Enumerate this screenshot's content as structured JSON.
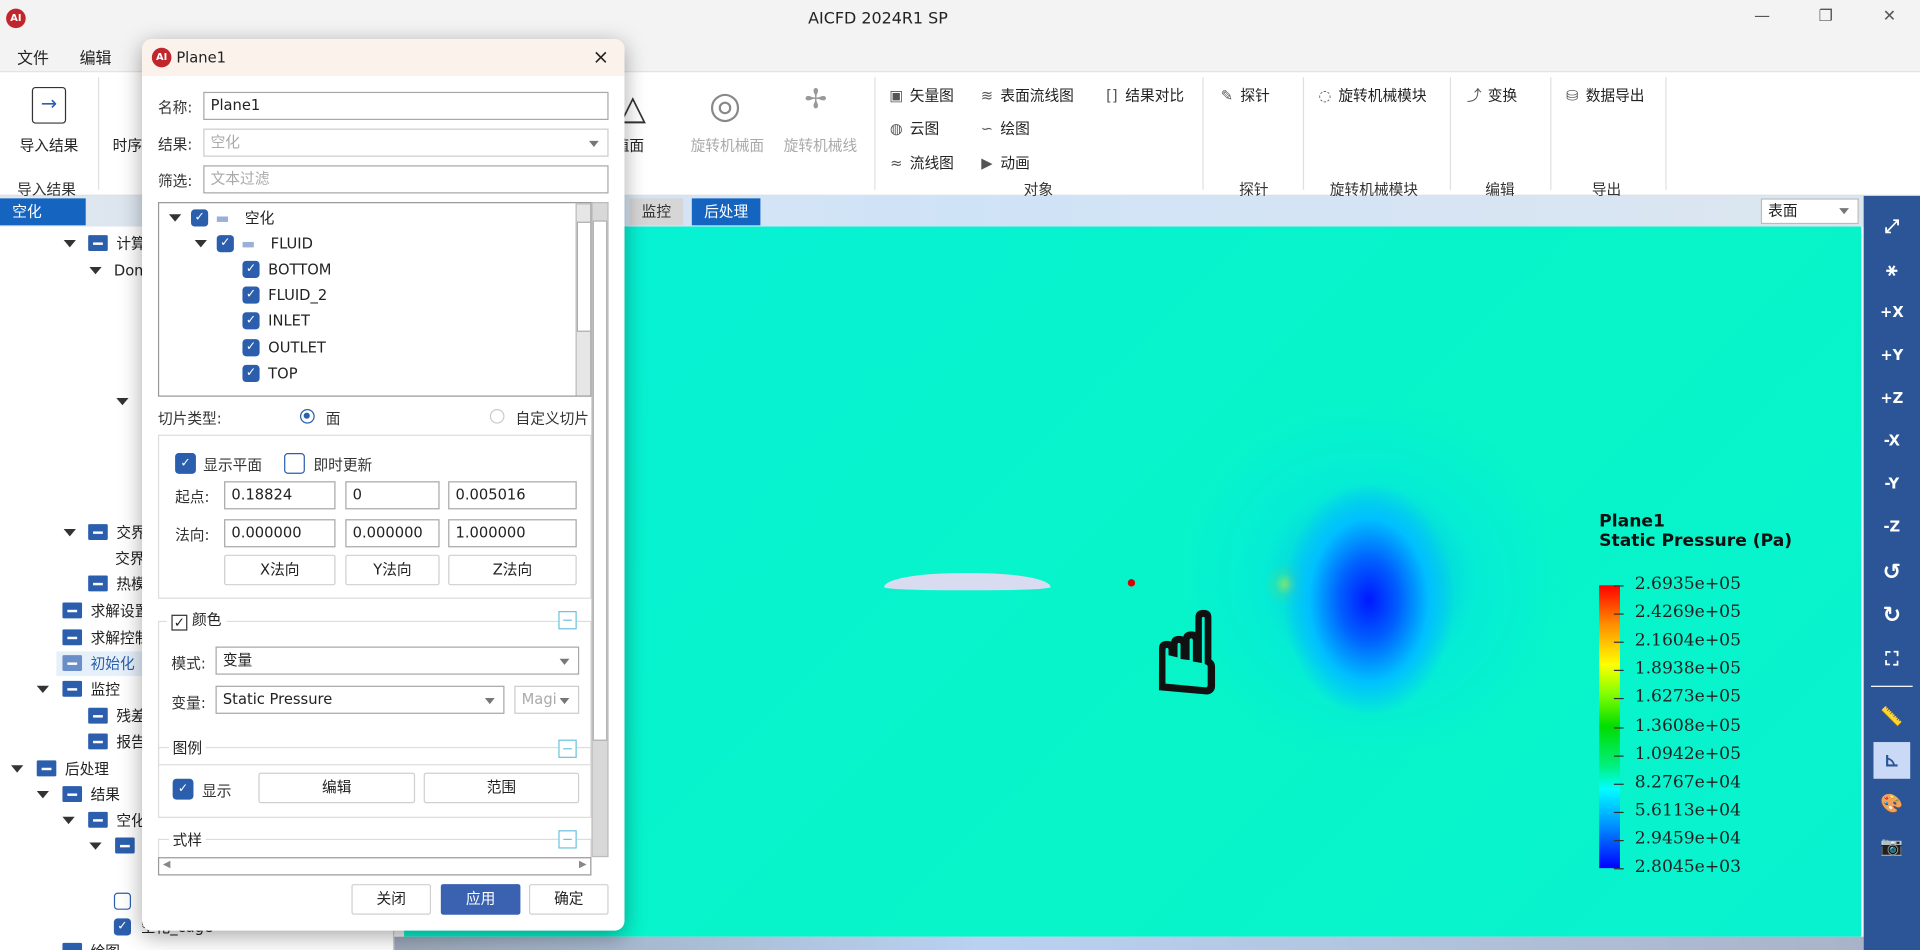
{
  "app": {
    "title": "AICFD 2024R1 SP",
    "logo_text": "AI"
  },
  "menu": [
    "文件",
    "编辑"
  ],
  "ribbon": {
    "import_button": "导入结果",
    "import_group": "导入结果",
    "timeseries_partial": "时序",
    "isosurface_partial": "等值面",
    "turbo_surface": "旋转机械面",
    "turbo_line": "旋转机械线",
    "objects": {
      "vector": "矢量图",
      "surface_streamline": "表面流线图",
      "compare": "结果对比",
      "contour": "云图",
      "plot": "绘图",
      "streamline": "流线图",
      "animation": "动画",
      "group": "对象"
    },
    "probe": {
      "button": "探针",
      "group": "探针"
    },
    "turbo_module": {
      "button": "旋转机械模块",
      "group": "旋转机械模块"
    },
    "edit": {
      "button": "变换",
      "group": "编辑"
    },
    "export": {
      "button": "数据导出",
      "group": "导出"
    }
  },
  "tabs": {
    "left": "空化",
    "monitor": "监控",
    "post": "后处理",
    "view_select": "表面"
  },
  "tree": [
    {
      "label": "计算",
      "depth": 3
    },
    {
      "label": "Dom",
      "depth": 4
    },
    {
      "label": "交界",
      "depth": 3
    },
    {
      "label": "交界",
      "depth": 4
    },
    {
      "label": "热模",
      "depth": 3
    },
    {
      "label": "求解设置",
      "depth": 2
    },
    {
      "label": "求解控制",
      "depth": 2
    },
    {
      "label": "初始化",
      "depth": 2,
      "selected": true
    },
    {
      "label": "监控",
      "depth": 2
    },
    {
      "label": "残差",
      "depth": 3
    },
    {
      "label": "报告",
      "depth": 3
    },
    {
      "label": "后处理",
      "depth": 1
    },
    {
      "label": "结果",
      "depth": 2
    },
    {
      "label": "空化",
      "depth": 3
    },
    {
      "label": "空化_cage",
      "depth": 5,
      "checked": true
    },
    {
      "label": "绘图",
      "depth": 2
    }
  ],
  "dialog": {
    "title": "Plane1",
    "close": "×",
    "name_label": "名称:",
    "name_value": "Plane1",
    "result_label": "结果:",
    "result_value": "空化",
    "filter_label": "筛选:",
    "filter_placeholder": "文本过滤",
    "zone_tree": [
      {
        "label": "空化",
        "folder": true,
        "checked": true
      },
      {
        "label": "FLUID",
        "folder": true,
        "checked": true
      },
      {
        "label": "BOTTOM",
        "checked": true
      },
      {
        "label": "FLUID_2",
        "checked": true
      },
      {
        "label": "INLET",
        "checked": true
      },
      {
        "label": "OUTLET",
        "checked": true
      },
      {
        "label": "TOP",
        "checked": true
      }
    ],
    "slice_type_label": "切片类型:",
    "slice_plane": "面",
    "slice_custom": "自定义切片",
    "slice_selected": "面",
    "show_plane": "显示平面",
    "show_plane_checked": true,
    "live_update": "即时更新",
    "live_update_checked": false,
    "origin_label": "起点:",
    "origin": [
      "0.18824",
      "0",
      "0.005016"
    ],
    "normal_label": "法向:",
    "normal": [
      "0.000000",
      "0.000000",
      "1.000000"
    ],
    "x_normal": "X法向",
    "y_normal": "Y法向",
    "z_normal": "Z法向",
    "color_section": "颜色",
    "color_checked": true,
    "mode_label": "模式:",
    "mode_value": "变量",
    "variable_label": "变量:",
    "variable_value": "Static Pressure",
    "component_value": "Magi",
    "legend_section": "图例",
    "legend_show": "显示",
    "legend_show_checked": true,
    "legend_edit": "编辑",
    "legend_range": "范围",
    "style_section": "式样",
    "btn_close": "关闭",
    "btn_apply": "应用",
    "btn_ok": "确定"
  },
  "legend": {
    "title": "Plane1",
    "variable": "Static Pressure (Pa)",
    "labels": [
      "2.6935e+05",
      "2.4269e+05",
      "2.1604e+05",
      "1.8938e+05",
      "1.6273e+05",
      "1.3608e+05",
      "1.0942e+05",
      "8.2767e+04",
      "5.6113e+04",
      "2.9459e+04",
      "2.8045e+03"
    ]
  },
  "colors": {
    "accent": "#1565c0",
    "toolbar": "#2c5597",
    "apply": "#3a62b0",
    "field": "#07f0d6"
  },
  "right_toolbar": [
    "fit-icon",
    "axes-icon",
    "+X",
    "+Y",
    "+Z",
    "-X",
    "-Y",
    "-Z",
    "rotate-ccw-90-icon",
    "rotate-cw-90-icon",
    "fullscreen-icon",
    "ruler-icon",
    "axis-hide-icon",
    "palette-icon",
    "camera-icon"
  ]
}
